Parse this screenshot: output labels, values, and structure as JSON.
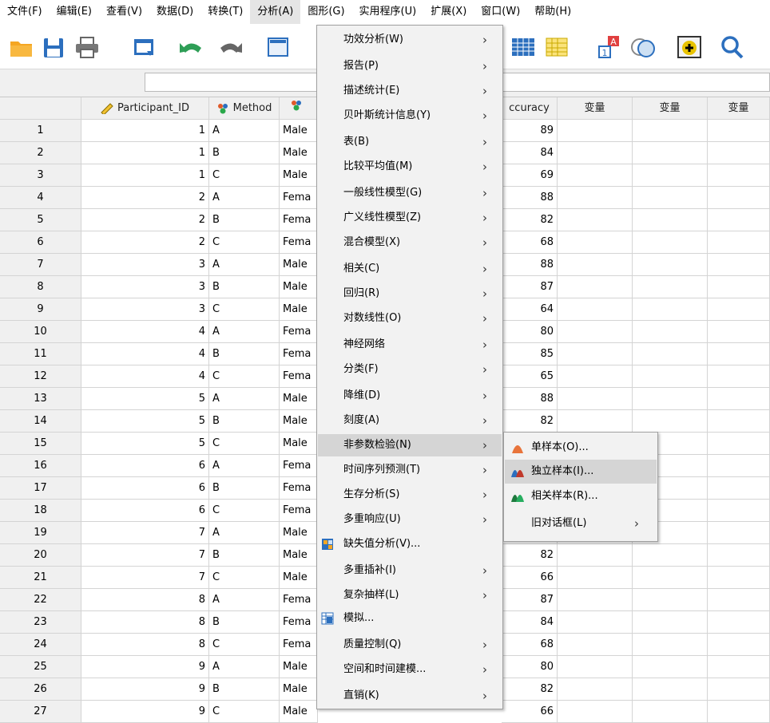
{
  "menubar": {
    "items": [
      {
        "label": "文件(F)"
      },
      {
        "label": "编辑(E)"
      },
      {
        "label": "查看(V)"
      },
      {
        "label": "数据(D)"
      },
      {
        "label": "转换(T)"
      },
      {
        "label": "分析(A)"
      },
      {
        "label": "图形(G)"
      },
      {
        "label": "实用程序(U)"
      },
      {
        "label": "扩展(X)"
      },
      {
        "label": "窗口(W)"
      },
      {
        "label": "帮助(H)"
      }
    ]
  },
  "toolbar": {
    "icons": [
      "open-folder-icon",
      "save-icon",
      "print-icon",
      "dialog-recall-icon",
      "undo-icon",
      "redo-icon",
      "goto-case-icon",
      "variables-icon",
      "split-file-icon",
      "value-labels-icon",
      "use-sets-icon",
      "spell-check-icon",
      "search-icon"
    ]
  },
  "grid": {
    "columns": [
      {
        "name": "Participant_ID",
        "icon": "scale-ruler-icon"
      },
      {
        "name": "Method",
        "icon": "nominal-icon"
      },
      {
        "name": "",
        "icon": "nominal-icon"
      },
      {
        "name": "ccuracy",
        "icon": ""
      },
      {
        "name": "变量"
      },
      {
        "name": "变量"
      },
      {
        "name": "变量"
      }
    ],
    "rows": [
      {
        "n": "1",
        "pid": "1",
        "method": "A",
        "gender": "Male",
        "acc": "89"
      },
      {
        "n": "2",
        "pid": "1",
        "method": "B",
        "gender": "Male",
        "acc": "84"
      },
      {
        "n": "3",
        "pid": "1",
        "method": "C",
        "gender": "Male",
        "acc": "69"
      },
      {
        "n": "4",
        "pid": "2",
        "method": "A",
        "gender": "Fema",
        "acc": "88"
      },
      {
        "n": "5",
        "pid": "2",
        "method": "B",
        "gender": "Fema",
        "acc": "82"
      },
      {
        "n": "6",
        "pid": "2",
        "method": "C",
        "gender": "Fema",
        "acc": "68"
      },
      {
        "n": "7",
        "pid": "3",
        "method": "A",
        "gender": "Male",
        "acc": "88"
      },
      {
        "n": "8",
        "pid": "3",
        "method": "B",
        "gender": "Male",
        "acc": "87"
      },
      {
        "n": "9",
        "pid": "3",
        "method": "C",
        "gender": "Male",
        "acc": "64"
      },
      {
        "n": "10",
        "pid": "4",
        "method": "A",
        "gender": "Fema",
        "acc": "80"
      },
      {
        "n": "11",
        "pid": "4",
        "method": "B",
        "gender": "Fema",
        "acc": "85"
      },
      {
        "n": "12",
        "pid": "4",
        "method": "C",
        "gender": "Fema",
        "acc": "65"
      },
      {
        "n": "13",
        "pid": "5",
        "method": "A",
        "gender": "Male",
        "acc": "88"
      },
      {
        "n": "14",
        "pid": "5",
        "method": "B",
        "gender": "Male",
        "acc": "82"
      },
      {
        "n": "15",
        "pid": "5",
        "method": "C",
        "gender": "Male",
        "acc": ""
      },
      {
        "n": "16",
        "pid": "6",
        "method": "A",
        "gender": "Fema",
        "acc": ""
      },
      {
        "n": "17",
        "pid": "6",
        "method": "B",
        "gender": "Fema",
        "acc": ""
      },
      {
        "n": "18",
        "pid": "6",
        "method": "C",
        "gender": "Fema",
        "acc": ""
      },
      {
        "n": "19",
        "pid": "7",
        "method": "A",
        "gender": "Male",
        "acc": ""
      },
      {
        "n": "20",
        "pid": "7",
        "method": "B",
        "gender": "Male",
        "acc": "82"
      },
      {
        "n": "21",
        "pid": "7",
        "method": "C",
        "gender": "Male",
        "acc": "66"
      },
      {
        "n": "22",
        "pid": "8",
        "method": "A",
        "gender": "Fema",
        "acc": "87"
      },
      {
        "n": "23",
        "pid": "8",
        "method": "B",
        "gender": "Fema",
        "acc": "84"
      },
      {
        "n": "24",
        "pid": "8",
        "method": "C",
        "gender": "Fema",
        "acc": "68"
      },
      {
        "n": "25",
        "pid": "9",
        "method": "A",
        "gender": "Male",
        "acc": "80"
      },
      {
        "n": "26",
        "pid": "9",
        "method": "B",
        "gender": "Male",
        "acc": "82"
      },
      {
        "n": "27",
        "pid": "9",
        "method": "C",
        "gender": "Male",
        "acc": "66"
      }
    ]
  },
  "analyze_menu": {
    "items": [
      {
        "label": "功效分析(W)",
        "sub": true
      },
      {
        "label": "报告(P)",
        "sub": true
      },
      {
        "label": "描述统计(E)",
        "sub": true
      },
      {
        "label": "贝叶斯统计信息(Y)",
        "sub": true
      },
      {
        "label": "表(B)",
        "sub": true
      },
      {
        "label": "比较平均值(M)",
        "sub": true
      },
      {
        "label": "一般线性模型(G)",
        "sub": true
      },
      {
        "label": "广义线性模型(Z)",
        "sub": true
      },
      {
        "label": "混合模型(X)",
        "sub": true
      },
      {
        "label": "相关(C)",
        "sub": true
      },
      {
        "label": "回归(R)",
        "sub": true
      },
      {
        "label": "对数线性(O)",
        "sub": true
      },
      {
        "label": "神经网络",
        "sub": true
      },
      {
        "label": "分类(F)",
        "sub": true
      },
      {
        "label": "降维(D)",
        "sub": true
      },
      {
        "label": "刻度(A)",
        "sub": true
      },
      {
        "label": "非参数检验(N)",
        "sub": true,
        "highlighted": true
      },
      {
        "label": "时间序列预测(T)",
        "sub": true
      },
      {
        "label": "生存分析(S)",
        "sub": true
      },
      {
        "label": "多重响应(U)",
        "sub": true
      },
      {
        "label": "缺失值分析(V)...",
        "sub": false,
        "icon": "missing-value-icon"
      },
      {
        "label": "多重插补(I)",
        "sub": true
      },
      {
        "label": "复杂抽样(L)",
        "sub": true
      },
      {
        "label": "模拟...",
        "sub": false,
        "icon": "simulation-icon"
      },
      {
        "label": "质量控制(Q)",
        "sub": true
      },
      {
        "label": "空间和时间建模...",
        "sub": true
      },
      {
        "label": "直销(K)",
        "sub": true
      }
    ]
  },
  "nonparam_submenu": {
    "items": [
      {
        "label": "单样本(O)...",
        "icon": "one-sample-icon",
        "color": "#e8743b"
      },
      {
        "label": "独立样本(I)...",
        "icon": "independent-samples-icon",
        "color": "#c0392b",
        "highlighted": true
      },
      {
        "label": "相关样本(R)...",
        "icon": "related-samples-icon",
        "color": "#27ae60"
      },
      {
        "label": "旧对话框(L)",
        "icon": "",
        "sub": true
      }
    ]
  },
  "colors": {
    "toolbar_blue": "#2c6fbe",
    "folder_orange": "#f5a623",
    "undo_green": "#2e9e56"
  }
}
